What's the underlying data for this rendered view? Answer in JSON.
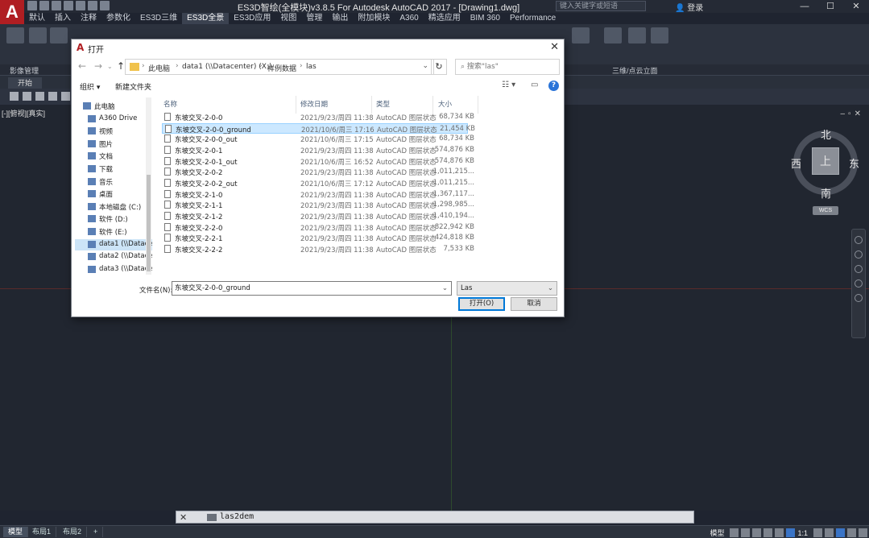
{
  "app": {
    "title": "ES3D智绘(全模块)v3.8.5 For Autodesk AutoCAD 2017 - [Drawing1.dwg]",
    "logo": "A",
    "search_placeholder": "键入关键字或短语",
    "login": "登录"
  },
  "ribbon_tabs": [
    "默认",
    "插入",
    "注释",
    "参数化",
    "ES3D三维",
    "ES3D全景",
    "ES3D应用",
    "视图",
    "管理",
    "输出",
    "附加模块",
    "A360",
    "精选应用",
    "BIM 360",
    "Performance"
  ],
  "ribbon_active_tab": "ES3D全景",
  "ribbon_panels": {
    "left": "影像管理",
    "right": "三维/点云立面"
  },
  "file_tab": "开始",
  "viewport_label": "[-][俯视][真实]",
  "viewcube": {
    "north": "北",
    "south": "南",
    "east": "东",
    "west": "西",
    "face": "上",
    "wcs": "WCS"
  },
  "command_line": {
    "close": "✕",
    "text": "las2dem"
  },
  "statusbar": {
    "tabs": [
      "模型",
      "布局1",
      "布局2"
    ],
    "add": "+",
    "model_label": "模型",
    "scale": "1:1"
  },
  "dialog": {
    "title": "打开",
    "close": "✕",
    "breadcrumb": [
      "此电脑",
      "data1 (\\\\Datacenter) (X:)",
      "样例数据",
      "las"
    ],
    "search_placeholder": "搜索\"las\"",
    "organize": "组织 ▾",
    "new_folder": "新建文件夹",
    "help": "?",
    "nav_items": [
      {
        "label": "此电脑",
        "icon": "computer-icon"
      },
      {
        "label": "A360 Drive",
        "icon": "cloud-icon"
      },
      {
        "label": "视频",
        "icon": "video-icon"
      },
      {
        "label": "图片",
        "icon": "picture-icon"
      },
      {
        "label": "文档",
        "icon": "document-icon"
      },
      {
        "label": "下载",
        "icon": "download-icon"
      },
      {
        "label": "音乐",
        "icon": "music-icon"
      },
      {
        "label": "桌面",
        "icon": "desktop-icon"
      },
      {
        "label": "本地磁盘 (C:)",
        "icon": "drive-icon"
      },
      {
        "label": "软件 (D:)",
        "icon": "drive-icon"
      },
      {
        "label": "软件 (E:)",
        "icon": "drive-icon"
      },
      {
        "label": "data1 (\\\\Datace",
        "icon": "network-drive-icon"
      },
      {
        "label": "data2 (\\\\Datace",
        "icon": "network-drive-icon"
      },
      {
        "label": "data3 (\\\\Datace",
        "icon": "network-drive-icon"
      }
    ],
    "selected_nav": 11,
    "columns": [
      "名称",
      "修改日期",
      "类型",
      "大小"
    ],
    "files": [
      {
        "name": "东坡交叉-2-0-0",
        "date": "2021/9/23/周四 11:38",
        "type": "AutoCAD 图层状态",
        "size": "68,734 KB"
      },
      {
        "name": "东坡交叉-2-0-0_ground",
        "date": "2021/10/6/周三 17:16",
        "type": "AutoCAD 图层状态",
        "size": "21,454 KB"
      },
      {
        "name": "东坡交叉-2-0-0_out",
        "date": "2021/10/6/周三 17:15",
        "type": "AutoCAD 图层状态",
        "size": "68,734 KB"
      },
      {
        "name": "东坡交叉-2-0-1",
        "date": "2021/9/23/周四 11:38",
        "type": "AutoCAD 图层状态",
        "size": "574,876 KB"
      },
      {
        "name": "东坡交叉-2-0-1_out",
        "date": "2021/10/6/周三 16:52",
        "type": "AutoCAD 图层状态",
        "size": "574,876 KB"
      },
      {
        "name": "东坡交叉-2-0-2",
        "date": "2021/9/23/周四 11:38",
        "type": "AutoCAD 图层状态",
        "size": "1,011,215..."
      },
      {
        "name": "东坡交叉-2-0-2_out",
        "date": "2021/10/6/周三 17:12",
        "type": "AutoCAD 图层状态",
        "size": "1,011,215..."
      },
      {
        "name": "东坡交叉-2-1-0",
        "date": "2021/9/23/周四 11:38",
        "type": "AutoCAD 图层状态",
        "size": "1,367,117..."
      },
      {
        "name": "东坡交叉-2-1-1",
        "date": "2021/9/23/周四 11:38",
        "type": "AutoCAD 图层状态",
        "size": "1,298,985..."
      },
      {
        "name": "东坡交叉-2-1-2",
        "date": "2021/9/23/周四 11:38",
        "type": "AutoCAD 图层状态",
        "size": "1,410,194..."
      },
      {
        "name": "东坡交叉-2-2-0",
        "date": "2021/9/23/周四 11:38",
        "type": "AutoCAD 图层状态",
        "size": "822,942 KB"
      },
      {
        "name": "东坡交叉-2-2-1",
        "date": "2021/9/23/周四 11:38",
        "type": "AutoCAD 图层状态",
        "size": "424,818 KB"
      },
      {
        "name": "东坡交叉-2-2-2",
        "date": "2021/9/23/周四 11:38",
        "type": "AutoCAD 图层状态",
        "size": "7,533 KB"
      }
    ],
    "selected_file": 1,
    "filename_label": "文件名(N):",
    "filename_value": "东坡交叉-2-0-0_ground",
    "filetype_value": "Las",
    "open_button": "打开(O)",
    "cancel_button": "取消"
  }
}
